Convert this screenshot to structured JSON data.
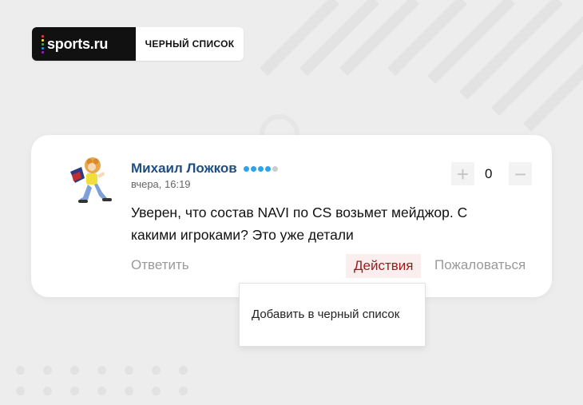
{
  "brand": {
    "logo_text": "sports.ru",
    "section_label": "ЧЕРНЫЙ СПИСОК"
  },
  "comment": {
    "author": "Михаил Ложков",
    "rating_level": 4,
    "rating_max": 5,
    "timestamp": "вчера, 16:19",
    "text": "Уверен, что состав NAVI по CS возьмет мейджор. С какими игроками? Это уже детали",
    "vote_count": "0",
    "vote_plus_icon": "+",
    "vote_minus_icon": "−",
    "reply_label": "Ответить",
    "actions_label": "Действия",
    "report_label": "Пожаловаться"
  },
  "dropdown": {
    "items": [
      {
        "label": "Добавить в черный список"
      }
    ]
  },
  "colors": {
    "author": "#1f4e82",
    "actions_text": "#9b1b1b",
    "actions_bg": "#fbeeee",
    "rating_filled": "#2ea3e6",
    "rating_empty": "#cccccc"
  }
}
